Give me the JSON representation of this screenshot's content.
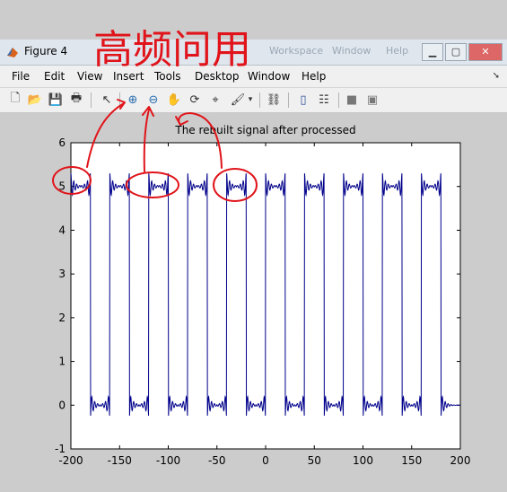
{
  "window": {
    "title": "Figure 4",
    "background_ghost": [
      "Workspace",
      "Window",
      "Help"
    ]
  },
  "menubar": {
    "items": [
      "File",
      "Edit",
      "View",
      "Insert",
      "Tools",
      "Desktop",
      "Window",
      "Help"
    ]
  },
  "toolbar": {
    "icons": [
      "new-figure-icon",
      "open-file-icon",
      "save-icon",
      "print-icon",
      "edit-plot-icon",
      "zoom-in-icon",
      "zoom-out-icon",
      "pan-icon",
      "rotate-3d-icon",
      "data-cursor-icon",
      "brush-icon",
      "link-plot-icon",
      "colorbar-icon",
      "legend-icon",
      "hide-plot-tools-icon",
      "show-plot-tools-icon"
    ]
  },
  "annotation": {
    "handwritten_text": "高频问用",
    "ink_color": "#e0141a"
  },
  "colors": {
    "signal": "#00008b",
    "background": "#cccccc"
  },
  "chart_data": {
    "type": "line",
    "title": "The  rebuilt signal after processed",
    "xlabel": "",
    "ylabel": "",
    "xlim": [
      -200,
      200
    ],
    "ylim": [
      -1,
      6
    ],
    "xticks": [
      "-200",
      "-150",
      "-100",
      "-50",
      "0",
      "50",
      "100",
      "150",
      "200"
    ],
    "yticks": [
      "-1",
      "0",
      "1",
      "2",
      "3",
      "4",
      "5",
      "6"
    ],
    "grid": false,
    "series": [
      {
        "description_high": 5,
        "description_low": 0,
        "period": 40,
        "high_segments": [
          [
            -200,
            -180
          ],
          [
            -160,
            -140
          ],
          [
            -120,
            -100
          ],
          [
            -80,
            -60
          ],
          [
            -40,
            -20
          ],
          [
            0,
            20
          ],
          [
            40,
            60
          ],
          [
            80,
            100
          ],
          [
            120,
            140
          ],
          [
            160,
            180
          ]
        ],
        "ripple_amplitude": 0.3
      }
    ]
  }
}
